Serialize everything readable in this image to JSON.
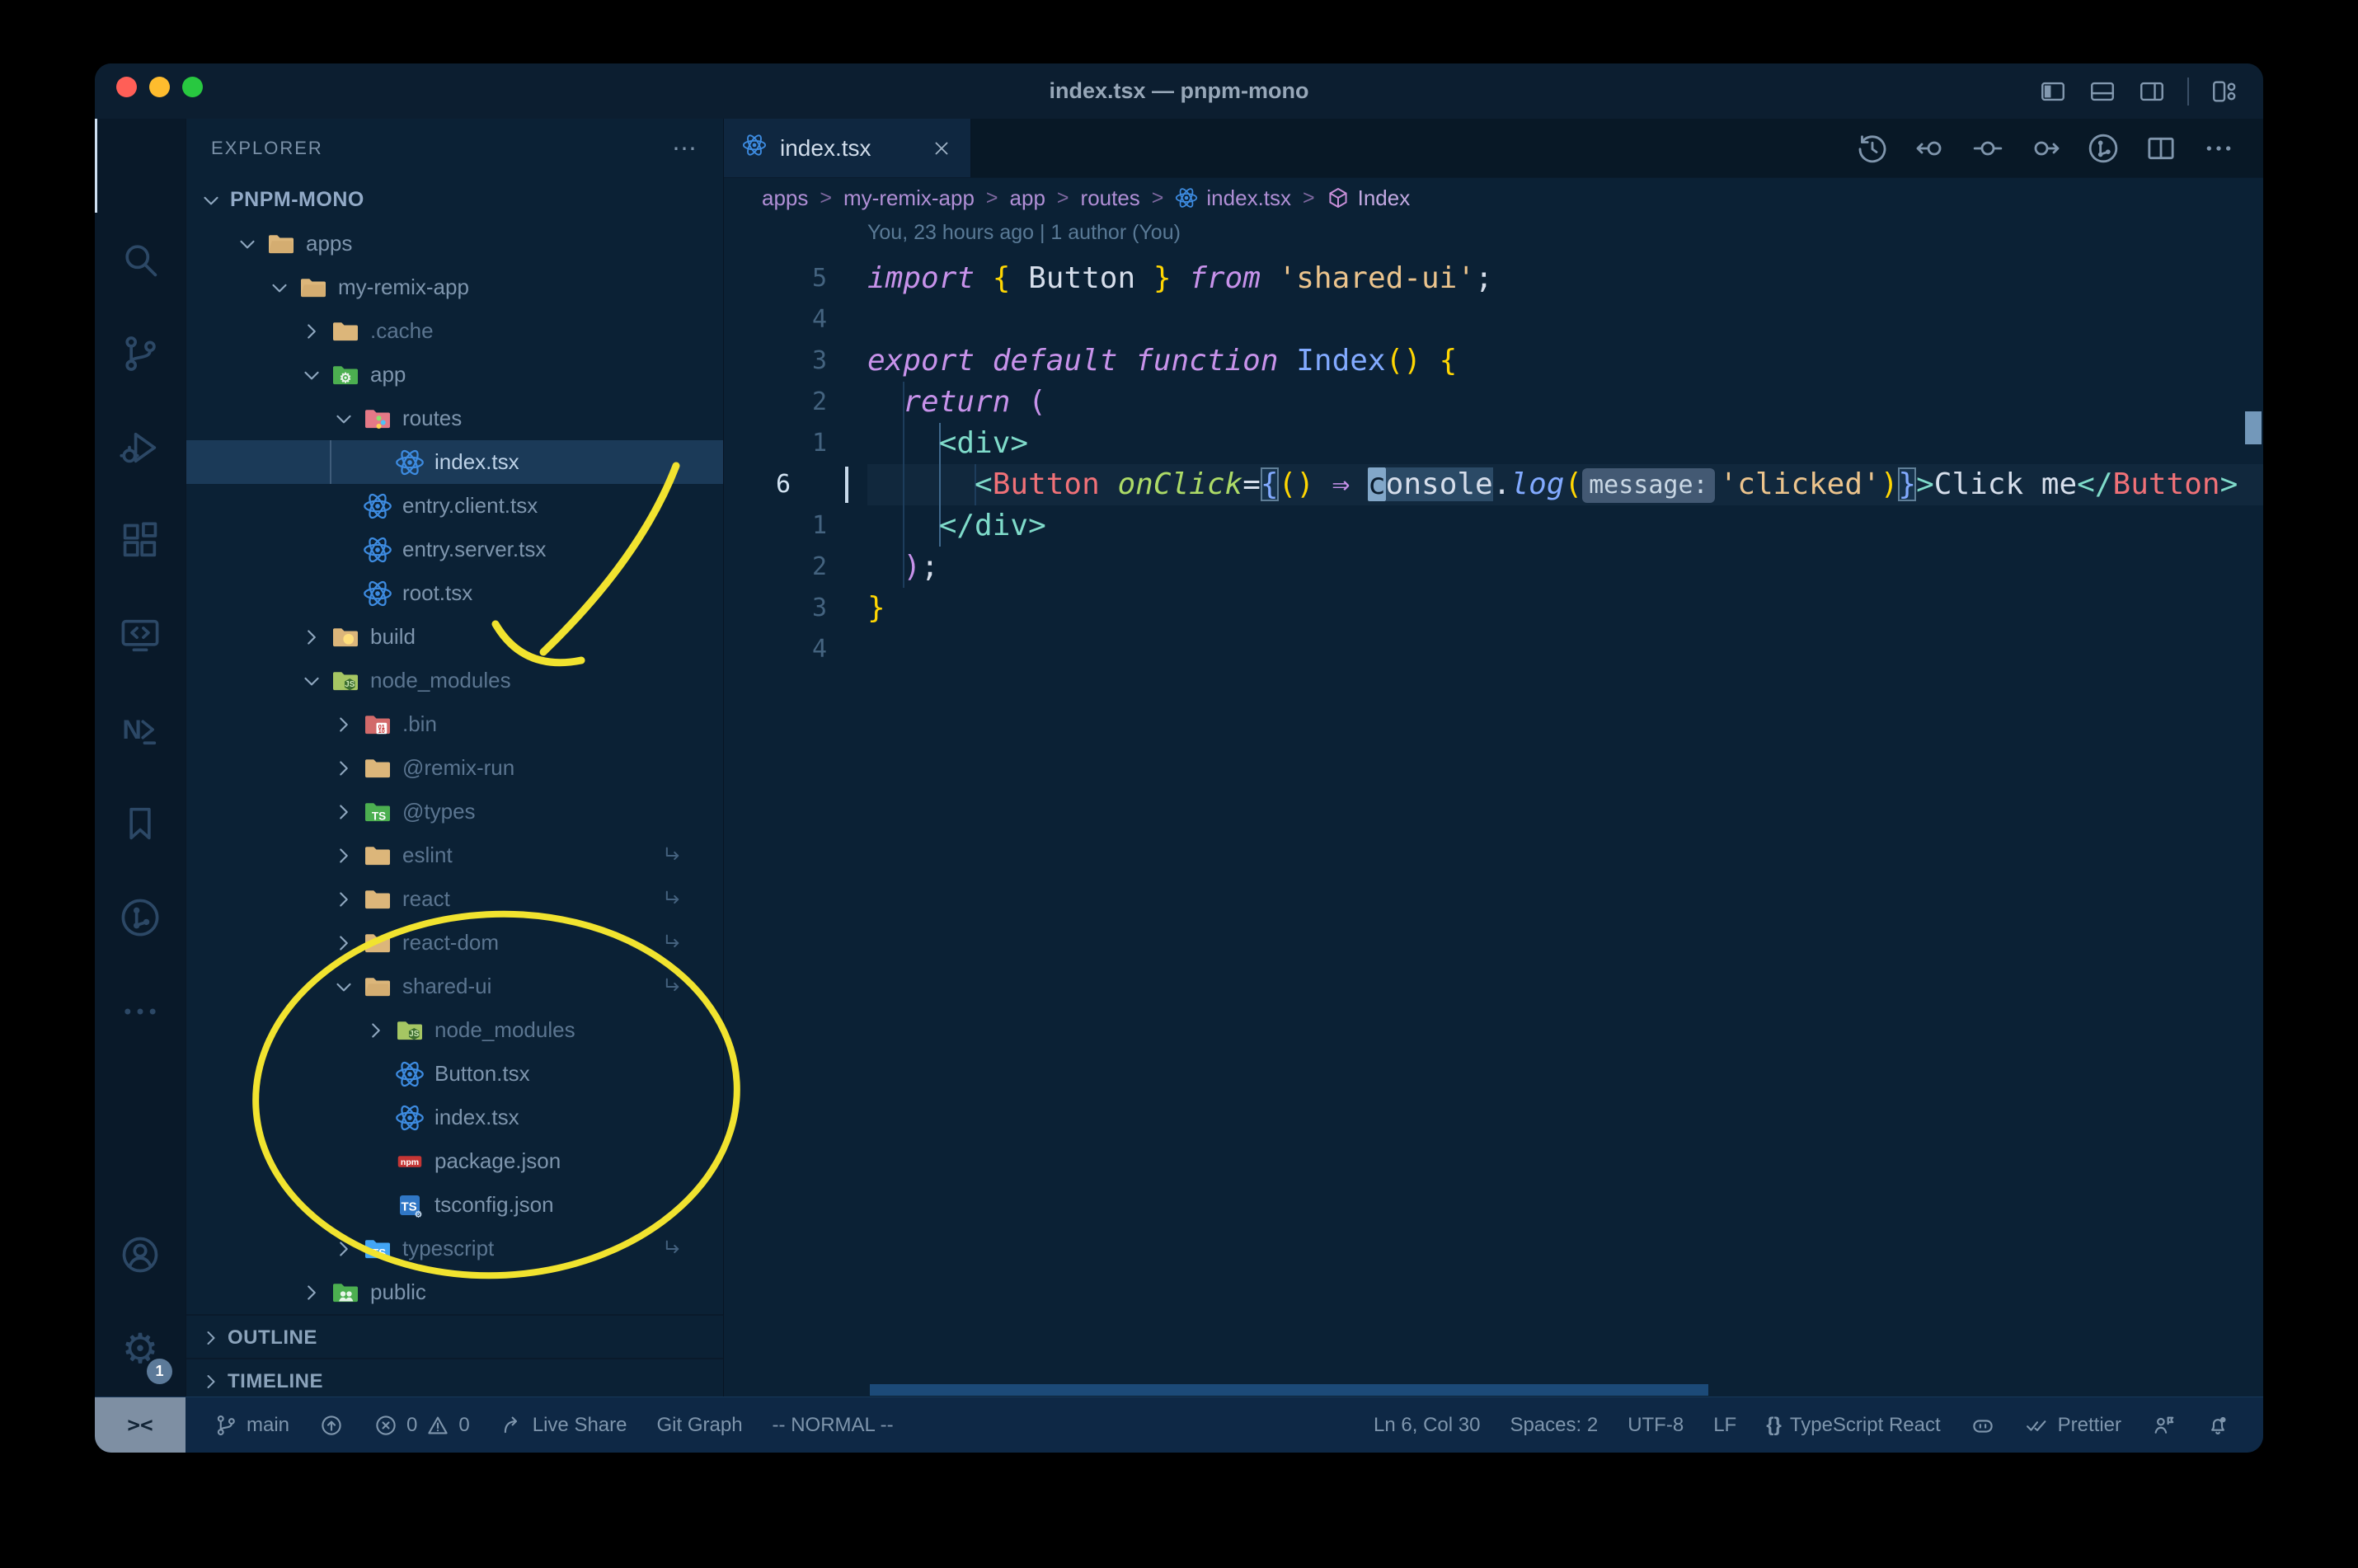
{
  "window": {
    "title": "index.tsx — pnpm-mono"
  },
  "titlebar": {
    "layout_icons": [
      "layout-sidebar-left",
      "layout-panel-bottom",
      "layout-sidebar-right",
      "layout-customize"
    ]
  },
  "activity_bar": {
    "items": [
      {
        "name": "explorer",
        "active": true
      },
      {
        "name": "search"
      },
      {
        "name": "source-control"
      },
      {
        "name": "run-debug"
      },
      {
        "name": "extensions"
      },
      {
        "name": "remote-explorer"
      },
      {
        "name": "nx-console"
      },
      {
        "name": "bookmarks"
      },
      {
        "name": "gitlens"
      },
      {
        "name": "more"
      }
    ],
    "bottom": [
      {
        "name": "accounts"
      },
      {
        "name": "settings",
        "badge": "1"
      }
    ]
  },
  "explorer": {
    "header": "EXPLORER",
    "more": "⋯",
    "root": "PNPM-MONO",
    "tree": [
      {
        "label": "PNPM-MONO",
        "level": 0,
        "kind": "root",
        "expanded": true
      },
      {
        "label": "apps",
        "level": 1,
        "icon": "folder-tan-open",
        "expanded": true
      },
      {
        "label": "my-remix-app",
        "level": 2,
        "icon": "folder-tan-open",
        "expanded": true
      },
      {
        "label": ".cache",
        "level": 3,
        "icon": "folder-tan",
        "expanded": false,
        "dim": true
      },
      {
        "label": "app",
        "level": 3,
        "icon": "folder-app",
        "expanded": true
      },
      {
        "label": "routes",
        "level": 4,
        "icon": "folder-routes",
        "expanded": true
      },
      {
        "label": "index.tsx",
        "level": 5,
        "icon": "react",
        "selected": true
      },
      {
        "label": "entry.client.tsx",
        "level": 4,
        "icon": "react"
      },
      {
        "label": "entry.server.tsx",
        "level": 4,
        "icon": "react"
      },
      {
        "label": "root.tsx",
        "level": 4,
        "icon": "react"
      },
      {
        "label": "build",
        "level": 3,
        "icon": "folder-build",
        "expanded": false
      },
      {
        "label": "node_modules",
        "level": 3,
        "icon": "folder-node",
        "expanded": true,
        "dim": true
      },
      {
        "label": ".bin",
        "level": 4,
        "icon": "folder-bin",
        "expanded": false,
        "dim": true
      },
      {
        "label": "@remix-run",
        "level": 4,
        "icon": "folder-tan",
        "expanded": false,
        "dim": true
      },
      {
        "label": "@types",
        "level": 4,
        "icon": "folder-types",
        "expanded": false,
        "dim": true
      },
      {
        "label": "eslint",
        "level": 4,
        "icon": "folder-tan",
        "expanded": false,
        "dim": true,
        "symlink": true
      },
      {
        "label": "react",
        "level": 4,
        "icon": "folder-tan",
        "expanded": false,
        "dim": true,
        "symlink": true
      },
      {
        "label": "react-dom",
        "level": 4,
        "icon": "folder-tan",
        "expanded": false,
        "dim": true,
        "symlink": true
      },
      {
        "label": "shared-ui",
        "level": 4,
        "icon": "folder-tan-open",
        "expanded": true,
        "dim": true,
        "symlink": true
      },
      {
        "label": "node_modules",
        "level": 5,
        "icon": "folder-node",
        "expanded": false,
        "dim": true
      },
      {
        "label": "Button.tsx",
        "level": 5,
        "icon": "react"
      },
      {
        "label": "index.tsx",
        "level": 5,
        "icon": "react"
      },
      {
        "label": "package.json",
        "level": 5,
        "icon": "npm"
      },
      {
        "label": "tsconfig.json",
        "level": 5,
        "icon": "tsconfig"
      },
      {
        "label": "typescript",
        "level": 4,
        "icon": "folder-tsblue",
        "expanded": false,
        "dim": true,
        "symlink": true
      },
      {
        "label": "public",
        "level": 3,
        "icon": "folder-public",
        "expanded": false
      }
    ],
    "sections": [
      {
        "label": "OUTLINE"
      },
      {
        "label": "TIMELINE"
      }
    ]
  },
  "editor": {
    "tab": {
      "label": "index.tsx",
      "icon": "react"
    },
    "actions": [
      "history",
      "prev-change",
      "change",
      "next-change",
      "gitlens-graph",
      "split-editor",
      "more"
    ],
    "breadcrumbs": [
      {
        "label": "apps"
      },
      {
        "label": "my-remix-app"
      },
      {
        "label": "app"
      },
      {
        "label": "routes"
      },
      {
        "label": "index.tsx",
        "icon": "react"
      },
      {
        "label": "Index",
        "icon": "symbol-module",
        "last": true
      }
    ],
    "blame": "You, 23 hours ago | 1 author (You)",
    "lines": [
      {
        "num": "5",
        "tokens": [
          [
            "kw",
            "import"
          ],
          [
            "ws",
            " "
          ],
          [
            "py",
            "{"
          ],
          [
            "var",
            " Button "
          ],
          [
            "py",
            "}"
          ],
          [
            "ws",
            " "
          ],
          [
            "kw",
            "from"
          ],
          [
            "ws",
            " "
          ],
          [
            "str",
            "'shared-ui'"
          ],
          [
            "pw",
            ";"
          ]
        ]
      },
      {
        "num": "4",
        "tokens": []
      },
      {
        "num": "3",
        "tokens": [
          [
            "kw",
            "export"
          ],
          [
            "ws",
            " "
          ],
          [
            "kw",
            "default"
          ],
          [
            "ws",
            " "
          ],
          [
            "kw",
            "function"
          ],
          [
            "ws",
            " "
          ],
          [
            "fn",
            "Index"
          ],
          [
            "py",
            "()"
          ],
          [
            "ws",
            " "
          ],
          [
            "py",
            "{"
          ]
        ]
      },
      {
        "num": "2",
        "tokens": [
          [
            "ws",
            "  "
          ],
          [
            "kw",
            "return"
          ],
          [
            "ws",
            " "
          ],
          [
            "pp",
            "("
          ]
        ]
      },
      {
        "num": "1",
        "tokens": [
          [
            "ws",
            "    "
          ],
          [
            "tag",
            "<div>"
          ]
        ]
      },
      {
        "num": "6",
        "current": true,
        "tokens": [
          [
            "ws",
            "      "
          ],
          [
            "tag",
            "<"
          ],
          [
            "comp",
            "Button"
          ],
          [
            "ws",
            " "
          ],
          [
            "attr",
            "onClick"
          ],
          [
            "pw",
            "="
          ],
          [
            "bm",
            "{"
          ],
          [
            "py",
            "()"
          ],
          [
            "ws",
            " "
          ],
          [
            "kw2",
            "⇒"
          ],
          [
            "ws",
            " "
          ],
          [
            "cur",
            "c"
          ],
          [
            "hl",
            "onsole"
          ],
          [
            "pw",
            "."
          ],
          [
            "meth",
            "log"
          ],
          [
            "py",
            "("
          ],
          [
            "inlay",
            "message:"
          ],
          [
            "str",
            "'clicked'"
          ],
          [
            "py",
            ")"
          ],
          [
            "bm",
            "}"
          ],
          [
            "tag",
            ">"
          ],
          [
            "var",
            "Click me"
          ],
          [
            "tag",
            "</"
          ],
          [
            "comp",
            "Button"
          ],
          [
            "tag",
            ">"
          ]
        ]
      },
      {
        "num": "1",
        "tokens": [
          [
            "ws",
            "    "
          ],
          [
            "tag",
            "</div>"
          ]
        ]
      },
      {
        "num": "2",
        "tokens": [
          [
            "ws",
            "  "
          ],
          [
            "pp",
            ")"
          ],
          [
            "pw",
            ";"
          ]
        ]
      },
      {
        "num": "3",
        "tokens": [
          [
            "py",
            "}"
          ]
        ]
      },
      {
        "num": "4",
        "tokens": []
      }
    ]
  },
  "status_bar": {
    "remote": "><",
    "left": [
      {
        "name": "git-branch",
        "icon": "branch",
        "label": "main"
      },
      {
        "name": "sync",
        "icon": "sync",
        "label": ""
      },
      {
        "name": "problems",
        "icon": "error",
        "label": "0",
        "icon2": "warning",
        "label2": "0"
      },
      {
        "name": "live-share",
        "icon": "share",
        "label": "Live Share"
      },
      {
        "name": "git-graph",
        "label": "Git Graph"
      },
      {
        "name": "vim-mode",
        "label": "-- NORMAL --"
      }
    ],
    "right": [
      {
        "name": "cursor-position",
        "label": "Ln 6, Col 30"
      },
      {
        "name": "indentation",
        "label": "Spaces: 2"
      },
      {
        "name": "encoding",
        "label": "UTF-8"
      },
      {
        "name": "eol",
        "label": "LF"
      },
      {
        "name": "language-mode",
        "icon": "braces",
        "label": "TypeScript React"
      },
      {
        "name": "copilot",
        "icon": "copilot",
        "label": ""
      },
      {
        "name": "prettier",
        "icon": "checks",
        "label": "Prettier"
      },
      {
        "name": "feedback",
        "icon": "person",
        "label": ""
      },
      {
        "name": "notifications",
        "icon": "bell",
        "label": ""
      }
    ]
  },
  "annotations": {
    "color": "#f1e32f",
    "shapes": [
      "hand-drawn arrow pointing to node_modules",
      "hand-drawn ellipse around shared-ui contents"
    ]
  },
  "colors": {
    "editor_bg": "#0b2135",
    "titlebar_bg": "#0c1e30",
    "activitybar_bg": "#091929",
    "statusbar_bg": "#0e2845",
    "remote_bg": "#7e8fa3",
    "selection_row": "#1b3a58",
    "annotation_yellow": "#f1e32f",
    "traffic_close": "#ff5f57",
    "traffic_min": "#febc2e",
    "traffic_zoom": "#28c840",
    "folder_tan": "#dcb67a",
    "folder_green": "#4caf50",
    "folder_routes": "#e57987",
    "folder_node": "#a5c663",
    "folder_bin": "#d26a6a",
    "folder_tsblue": "#42a5f5",
    "react_blue": "#3d8be0",
    "npm_red": "#c53635",
    "ts_blue": "#3077c6"
  }
}
